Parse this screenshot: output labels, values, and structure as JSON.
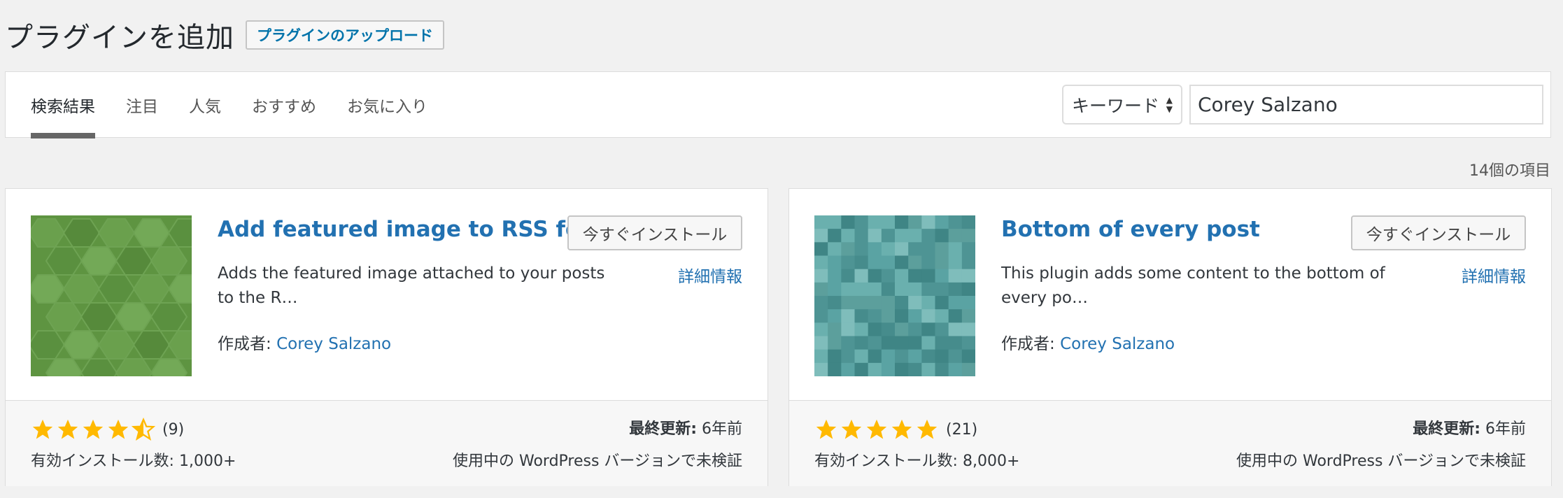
{
  "header": {
    "title": "プラグインを追加",
    "upload_button": "プラグインのアップロード"
  },
  "filter": {
    "tabs": [
      {
        "label": "検索結果",
        "active": true
      },
      {
        "label": "注目",
        "active": false
      },
      {
        "label": "人気",
        "active": false
      },
      {
        "label": "おすすめ",
        "active": false
      },
      {
        "label": "お気に入り",
        "active": false
      }
    ],
    "search_type": "キーワード",
    "search_value": "Corey Salzano"
  },
  "result_count": "14個の項目",
  "plugins": [
    {
      "name": "Add featured image to RSS feed",
      "install_label": "今すぐインストール",
      "details_label": "詳細情報",
      "description": "Adds the featured image attached to your posts to the R…",
      "author_label": "作成者:",
      "author": "Corey Salzano",
      "rating": 4.5,
      "rating_count": "(9)",
      "installs": "有効インストール数: 1,000+",
      "updated_label": "最終更新:",
      "updated_value": "6年前",
      "compat": "使用中の WordPress バージョンで未検証",
      "thumb_icon": "hexagon-pattern-icon",
      "thumb_color": "#5e9441"
    },
    {
      "name": "Bottom of every post",
      "install_label": "今すぐインストール",
      "details_label": "詳細情報",
      "description": "This plugin adds some content to the bottom of every po…",
      "author_label": "作成者:",
      "author": "Corey Salzano",
      "rating": 5,
      "rating_count": "(21)",
      "installs": "有効インストール数: 8,000+",
      "updated_label": "最終更新:",
      "updated_value": "6年前",
      "compat": "使用中の WordPress バージョンで未検証",
      "thumb_icon": "pixel-mosaic-icon",
      "thumb_color": "#4e9494"
    }
  ],
  "colors": {
    "link": "#2271b1",
    "star": "#ffb900",
    "background": "#f1f1f1"
  }
}
